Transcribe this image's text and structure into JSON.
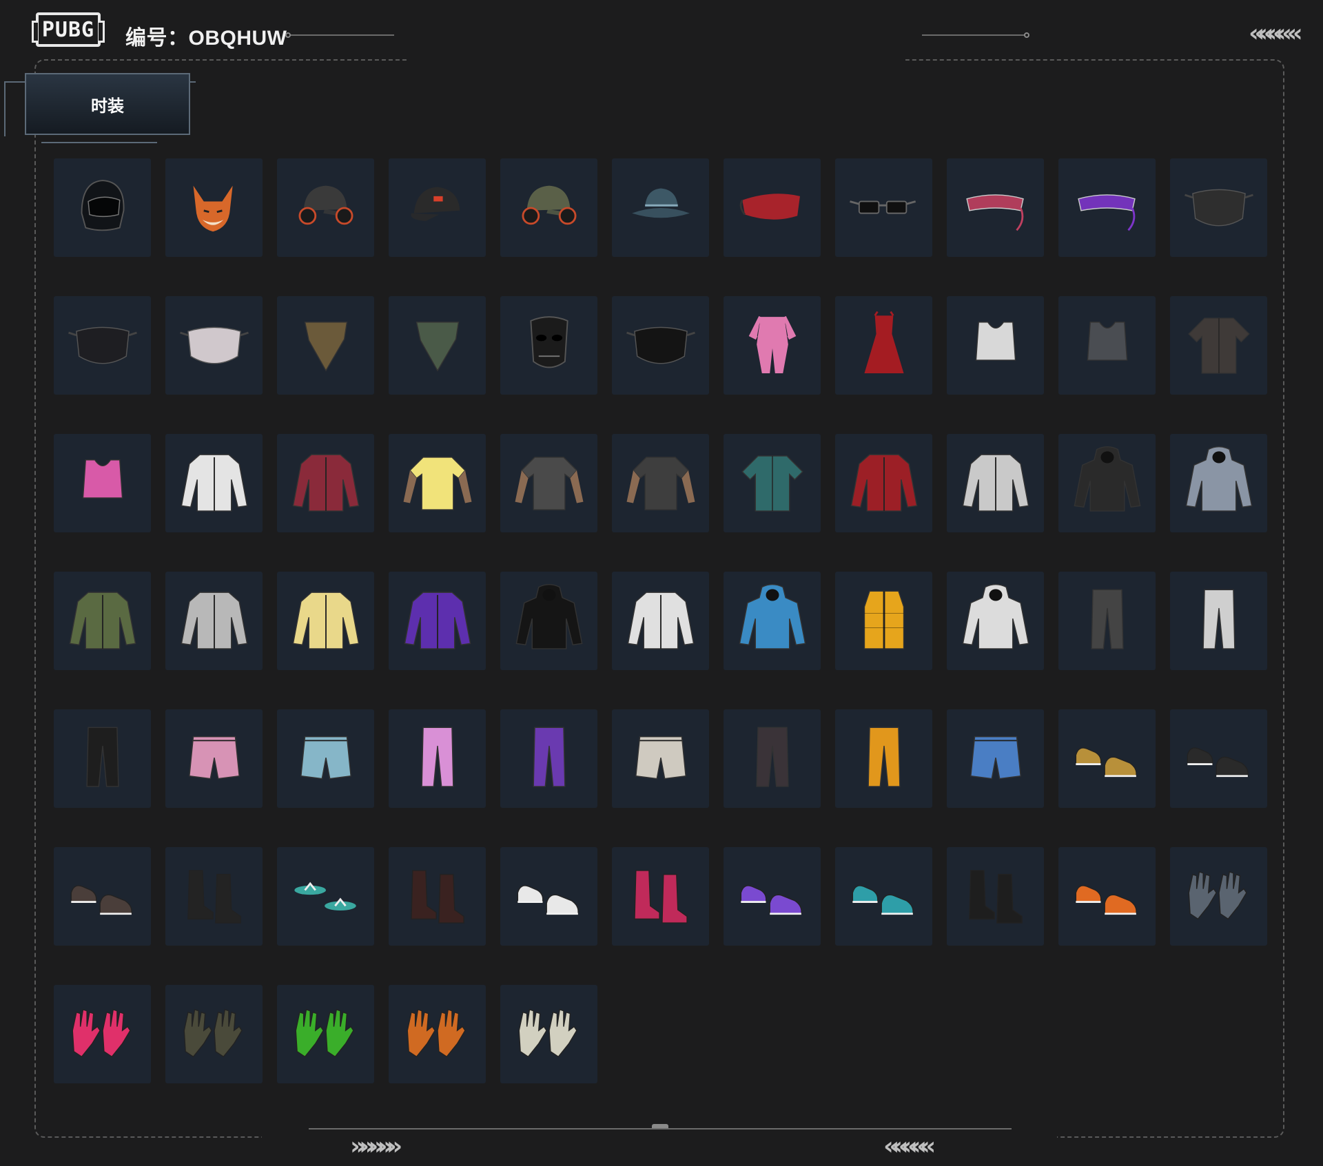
{
  "header": {
    "logo_text": "PUBG",
    "id_label": "编号：OBQHUW"
  },
  "tabs": [
    {
      "label": "时装",
      "selected": true
    }
  ],
  "decor": {
    "chevrons_right": "»»»»»",
    "chevrons_left": "«««««",
    "chevrons_top_right": "««««  «"
  },
  "items": [
    {
      "name": "full-face-helmet",
      "icon": "helmet",
      "color": "#111418"
    },
    {
      "name": "fox-mask",
      "icon": "fox-head",
      "color": "#d8682a"
    },
    {
      "name": "cap-with-headset",
      "icon": "cap-headset",
      "color": "#3a3a3a"
    },
    {
      "name": "black-baseball-cap",
      "icon": "cap",
      "color": "#2a2a2a"
    },
    {
      "name": "military-cap-headset",
      "icon": "cap-headset",
      "color": "#5a6048"
    },
    {
      "name": "bucket-hat",
      "icon": "bucket-hat",
      "color": "#3d5866"
    },
    {
      "name": "red-sleep-mask",
      "icon": "eye-mask",
      "color": "#a8232b"
    },
    {
      "name": "black-glasses",
      "icon": "glasses",
      "color": "#101010"
    },
    {
      "name": "cyber-visor-pink",
      "icon": "visor",
      "color": "#c04060"
    },
    {
      "name": "purple-visor",
      "icon": "visor",
      "color": "#7d35c9"
    },
    {
      "name": "miramar-face-mask",
      "icon": "face-mask",
      "color": "#2e2e2e"
    },
    {
      "name": "black-cloth-mask",
      "icon": "face-mask",
      "color": "#1e1e22"
    },
    {
      "name": "spiked-printed-mask",
      "icon": "face-mask",
      "color": "#d0c8cc"
    },
    {
      "name": "bandana-gold",
      "icon": "bandana",
      "color": "#6b5a3a"
    },
    {
      "name": "camo-scarf",
      "icon": "bandana",
      "color": "#4a5a48"
    },
    {
      "name": "black-skull-mask",
      "icon": "skull-mask",
      "color": "#1b1b1b"
    },
    {
      "name": "shark-teeth-mask",
      "icon": "face-mask",
      "color": "#141414"
    },
    {
      "name": "pink-jumpsuit",
      "icon": "jumpsuit",
      "color": "#e07ab0"
    },
    {
      "name": "red-dress",
      "icon": "dress",
      "color": "#a41c22"
    },
    {
      "name": "white-sports-bra",
      "icon": "sports-top",
      "color": "#d8d8d8"
    },
    {
      "name": "grey-tactical-top",
      "icon": "sports-top",
      "color": "#4a4d52"
    },
    {
      "name": "armored-shirt",
      "icon": "shirt",
      "color": "#3f3a38"
    },
    {
      "name": "pink-crop-top",
      "icon": "sports-top",
      "color": "#d85aa8"
    },
    {
      "name": "white-crop-jacket",
      "icon": "jacket",
      "color": "#e4e4e4"
    },
    {
      "name": "striped-sweater",
      "icon": "jacket",
      "color": "#8a2a3a"
    },
    {
      "name": "yellow-sleeve-tee",
      "icon": "tshirt",
      "color": "#f1e37a"
    },
    {
      "name": "tattoo-tee-grey",
      "icon": "tshirt",
      "color": "#4a4a4a"
    },
    {
      "name": "tattoo-tee-dark",
      "icon": "tshirt",
      "color": "#3e3e3e"
    },
    {
      "name": "floral-shirt",
      "icon": "shirt",
      "color": "#2f6a6a"
    },
    {
      "name": "red-leather-jacket",
      "icon": "jacket",
      "color": "#9c1f26"
    },
    {
      "name": "silver-jacket",
      "icon": "jacket",
      "color": "#c9c9c9"
    },
    {
      "name": "black-hooded-jacket",
      "icon": "hoodie",
      "color": "#2a2a2a"
    },
    {
      "name": "grey-hooded-coat",
      "icon": "hoodie",
      "color": "#8a95a5"
    },
    {
      "name": "olive-bolero",
      "icon": "jacket",
      "color": "#5a6a42"
    },
    {
      "name": "silver-orange-jacket",
      "icon": "jacket",
      "color": "#b8b8b8"
    },
    {
      "name": "yellow-fleece",
      "icon": "jacket",
      "color": "#e9d88a"
    },
    {
      "name": "purple-racing-jacket",
      "icon": "jacket",
      "color": "#5d2fae"
    },
    {
      "name": "black-aura-hoodie",
      "icon": "hoodie",
      "color": "#151515"
    },
    {
      "name": "white-orange-vest-jacket",
      "icon": "jacket",
      "color": "#e0e0e0"
    },
    {
      "name": "blue-gradient-hoodie",
      "icon": "hoodie",
      "color": "#3a8bc4"
    },
    {
      "name": "yellow-puffer-vest",
      "icon": "vest",
      "color": "#e6a51c"
    },
    {
      "name": "white-green-hoodie",
      "icon": "hoodie",
      "color": "#dcdcdc"
    },
    {
      "name": "grey-leggings",
      "icon": "pants",
      "color": "#444"
    },
    {
      "name": "white-cargo-pants",
      "icon": "pants",
      "color": "#cfcfcf"
    },
    {
      "name": "biker-chaps",
      "icon": "pants",
      "color": "#1e1e1e"
    },
    {
      "name": "pink-plaid-shorts",
      "icon": "shorts",
      "color": "#d793b5"
    },
    {
      "name": "denim-shorts",
      "icon": "shorts",
      "color": "#86b6c8"
    },
    {
      "name": "anime-print-pants",
      "icon": "pants",
      "color": "#d990d6"
    },
    {
      "name": "purple-stockings",
      "icon": "pants",
      "color": "#6a3ab0"
    },
    {
      "name": "white-cargo-shorts",
      "icon": "shorts",
      "color": "#cfcac0"
    },
    {
      "name": "camo-pants",
      "icon": "pants",
      "color": "#3a3338"
    },
    {
      "name": "orange-joggers",
      "icon": "pants",
      "color": "#e1971c"
    },
    {
      "name": "blue-gradient-shorts",
      "icon": "shorts",
      "color": "#4a7ec4"
    },
    {
      "name": "gold-dress-shoes",
      "icon": "shoes",
      "color": "#b8903a"
    },
    {
      "name": "black-high-tops",
      "icon": "shoes",
      "color": "#2a2a2a"
    },
    {
      "name": "paw-slippers",
      "icon": "shoes",
      "color": "#4a3e3a"
    },
    {
      "name": "black-ankle-boots",
      "icon": "boots",
      "color": "#232323"
    },
    {
      "name": "teal-flip-flops",
      "icon": "flip-flops",
      "color": "#3aa8a0"
    },
    {
      "name": "red-lace-boots",
      "icon": "boots",
      "color": "#3a2220"
    },
    {
      "name": "white-red-sneakers",
      "icon": "shoes",
      "color": "#e8e8e8"
    },
    {
      "name": "striped-boots",
      "icon": "boots",
      "color": "#c02a5a"
    },
    {
      "name": "purple-white-sneakers",
      "icon": "shoes",
      "color": "#7a4ad0"
    },
    {
      "name": "teal-clogs",
      "icon": "shoes",
      "color": "#2e9ea8"
    },
    {
      "name": "fur-trim-boots",
      "icon": "boots",
      "color": "#1e1e1e"
    },
    {
      "name": "orange-high-tops",
      "icon": "shoes",
      "color": "#e06a22"
    },
    {
      "name": "fingerless-gloves",
      "icon": "gloves",
      "color": "#5a6470"
    },
    {
      "name": "pink-racing-gloves",
      "icon": "gloves",
      "color": "#e0306a"
    },
    {
      "name": "camo-tactical-gloves",
      "icon": "gloves",
      "color": "#4a4a3a"
    },
    {
      "name": "green-gloves",
      "icon": "gloves",
      "color": "#3aae2a"
    },
    {
      "name": "orange-armored-gloves",
      "icon": "gloves",
      "color": "#d06a22"
    },
    {
      "name": "work-gloves",
      "icon": "gloves",
      "color": "#d2d0c0"
    }
  ]
}
